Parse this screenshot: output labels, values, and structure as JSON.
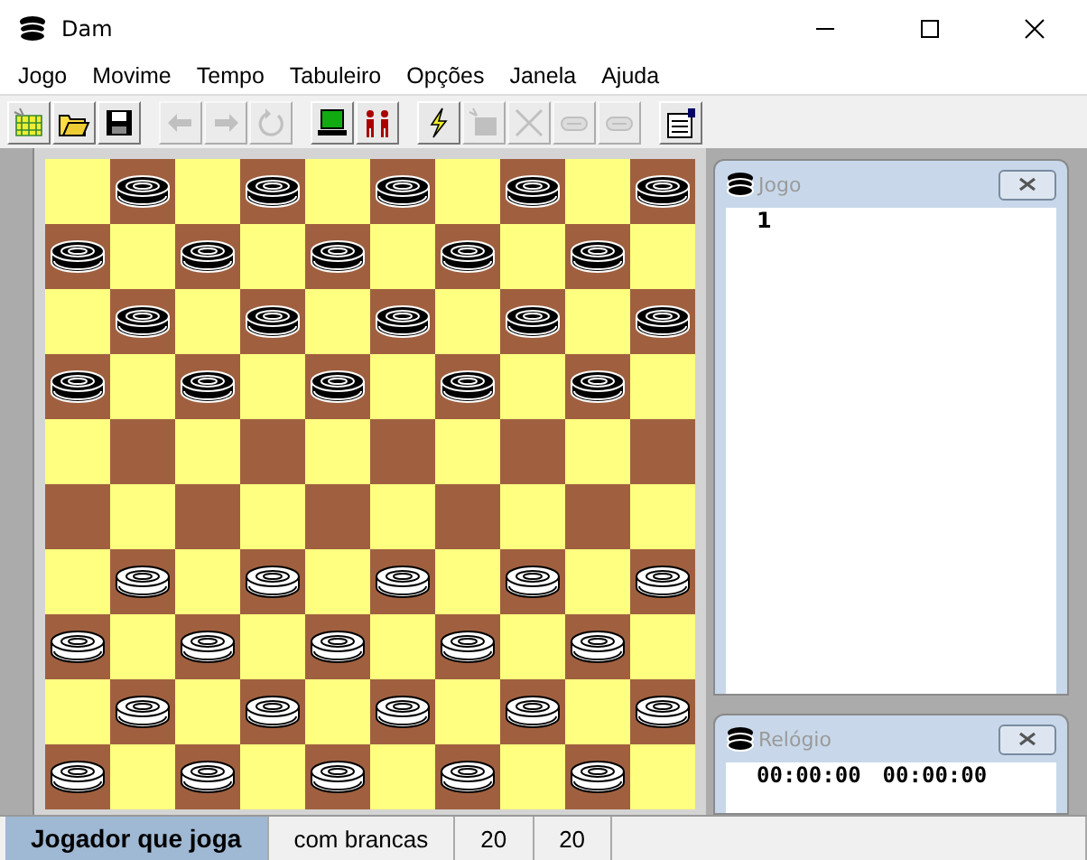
{
  "window": {
    "title": "Dam"
  },
  "menu": [
    "Jogo",
    "Movime",
    "Tempo",
    "Tabuleiro",
    "Opções",
    "Janela",
    "Ajuda"
  ],
  "toolbar": [
    [
      {
        "kind": "new",
        "disabled": false
      },
      {
        "kind": "open",
        "disabled": false
      },
      {
        "kind": "save",
        "disabled": false
      }
    ],
    [
      {
        "kind": "back",
        "disabled": true
      },
      {
        "kind": "forward",
        "disabled": true
      },
      {
        "kind": "undo",
        "disabled": true
      }
    ],
    [
      {
        "kind": "computer",
        "disabled": false
      },
      {
        "kind": "players",
        "disabled": false
      }
    ],
    [
      {
        "kind": "lightning",
        "disabled": false
      },
      {
        "kind": "setup",
        "disabled": true
      },
      {
        "kind": "clear",
        "disabled": true
      },
      {
        "kind": "piece",
        "disabled": true
      },
      {
        "kind": "piece",
        "disabled": true
      }
    ],
    [
      {
        "kind": "properties",
        "disabled": false
      }
    ]
  ],
  "board": {
    "rows": [
      [
        {
          "kind": "empty"
        },
        {
          "kind": "black"
        },
        {
          "kind": "empty"
        },
        {
          "kind": "black"
        },
        {
          "kind": "empty"
        },
        {
          "kind": "black"
        },
        {
          "kind": "empty"
        },
        {
          "kind": "black"
        },
        {
          "kind": "empty"
        },
        {
          "kind": "black"
        }
      ],
      [
        {
          "kind": "black"
        },
        {
          "kind": "empty"
        },
        {
          "kind": "black"
        },
        {
          "kind": "empty"
        },
        {
          "kind": "black"
        },
        {
          "kind": "empty"
        },
        {
          "kind": "black"
        },
        {
          "kind": "empty"
        },
        {
          "kind": "black"
        },
        {
          "kind": "empty"
        }
      ],
      [
        {
          "kind": "empty"
        },
        {
          "kind": "black"
        },
        {
          "kind": "empty"
        },
        {
          "kind": "black"
        },
        {
          "kind": "empty"
        },
        {
          "kind": "black"
        },
        {
          "kind": "empty"
        },
        {
          "kind": "black"
        },
        {
          "kind": "empty"
        },
        {
          "kind": "black"
        }
      ],
      [
        {
          "kind": "black"
        },
        {
          "kind": "empty"
        },
        {
          "kind": "black"
        },
        {
          "kind": "empty"
        },
        {
          "kind": "black"
        },
        {
          "kind": "empty"
        },
        {
          "kind": "black"
        },
        {
          "kind": "empty"
        },
        {
          "kind": "black"
        },
        {
          "kind": "empty"
        }
      ],
      [
        {
          "kind": "empty"
        },
        {
          "kind": "empty"
        },
        {
          "kind": "empty"
        },
        {
          "kind": "empty"
        },
        {
          "kind": "empty"
        },
        {
          "kind": "empty"
        },
        {
          "kind": "empty"
        },
        {
          "kind": "empty"
        },
        {
          "kind": "empty"
        },
        {
          "kind": "empty"
        }
      ],
      [
        {
          "kind": "empty"
        },
        {
          "kind": "empty"
        },
        {
          "kind": "empty"
        },
        {
          "kind": "empty"
        },
        {
          "kind": "empty"
        },
        {
          "kind": "empty"
        },
        {
          "kind": "empty"
        },
        {
          "kind": "empty"
        },
        {
          "kind": "empty"
        },
        {
          "kind": "empty"
        }
      ],
      [
        {
          "kind": "empty"
        },
        {
          "kind": "white"
        },
        {
          "kind": "empty"
        },
        {
          "kind": "white"
        },
        {
          "kind": "empty"
        },
        {
          "kind": "white"
        },
        {
          "kind": "empty"
        },
        {
          "kind": "white"
        },
        {
          "kind": "empty"
        },
        {
          "kind": "white"
        }
      ],
      [
        {
          "kind": "white"
        },
        {
          "kind": "empty"
        },
        {
          "kind": "white"
        },
        {
          "kind": "empty"
        },
        {
          "kind": "white"
        },
        {
          "kind": "empty"
        },
        {
          "kind": "white"
        },
        {
          "kind": "empty"
        },
        {
          "kind": "white"
        },
        {
          "kind": "empty"
        }
      ],
      [
        {
          "kind": "empty"
        },
        {
          "kind": "white"
        },
        {
          "kind": "empty"
        },
        {
          "kind": "white"
        },
        {
          "kind": "empty"
        },
        {
          "kind": "white"
        },
        {
          "kind": "empty"
        },
        {
          "kind": "white"
        },
        {
          "kind": "empty"
        },
        {
          "kind": "white"
        }
      ],
      [
        {
          "kind": "white"
        },
        {
          "kind": "empty"
        },
        {
          "kind": "white"
        },
        {
          "kind": "empty"
        },
        {
          "kind": "white"
        },
        {
          "kind": "empty"
        },
        {
          "kind": "white"
        },
        {
          "kind": "empty"
        },
        {
          "kind": "white"
        },
        {
          "kind": "empty"
        }
      ]
    ]
  },
  "moves_panel": {
    "title": "Jogo",
    "lines": [
      "1"
    ]
  },
  "clock_panel": {
    "title": "Relógio",
    "times": [
      "00:00:00",
      "00:00:00"
    ]
  },
  "status_bar": [
    {
      "text": "Jogador que joga",
      "selected": true
    },
    {
      "text": "com brancas",
      "selected": false
    },
    {
      "text": "20",
      "selected": false
    },
    {
      "text": "20",
      "selected": false
    }
  ]
}
